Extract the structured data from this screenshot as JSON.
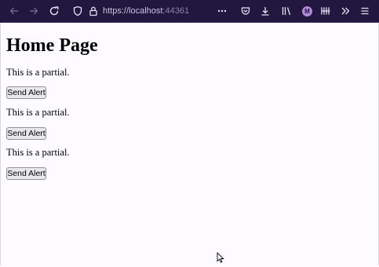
{
  "browser": {
    "url_host": "https://localhost",
    "url_port": ":44361",
    "avatar_letter": "M",
    "icons": [
      "back-icon",
      "forward-icon",
      "reload-icon",
      "shield-icon",
      "lock-icon",
      "more-icon",
      "pocket-icon",
      "download-icon",
      "library-icon",
      "account-icon",
      "extensions-icon",
      "overflow-icon",
      "menu-icon"
    ]
  },
  "page": {
    "title": "Home Page",
    "partials": [
      {
        "text": "This is a partial.",
        "button_label": "Send Alert"
      },
      {
        "text": "This is a partial.",
        "button_label": "Send Alert"
      },
      {
        "text": "This is a partial.",
        "button_label": "Send Alert"
      }
    ]
  },
  "colors": {
    "toolbar_bg": "#22173f",
    "page_bg": "#fdfbff",
    "account_accent": "#b08ad8"
  }
}
